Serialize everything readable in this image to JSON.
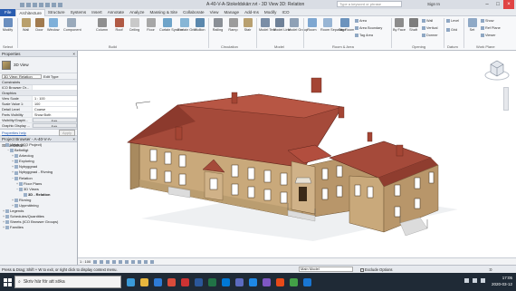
{
  "window": {
    "title": "A-40-V-A-Stokeldskärr.rvt - 3D View 3D: Relation",
    "search_placeholder": "Type a keyword or phrase",
    "sign_in": "Sign In"
  },
  "tabs": [
    "File",
    "Architecture",
    "Structure",
    "Systems",
    "Insert",
    "Annotate",
    "Analyze",
    "Massing & Site",
    "Collaborate",
    "View",
    "Manage",
    "Add-Ins",
    "Modify",
    "ICO"
  ],
  "active_tab": "Architecture",
  "ribbon": {
    "select": {
      "label": "Modify",
      "panel": "Select"
    },
    "build": {
      "panel": "Build",
      "buttons": [
        "Wall",
        "Door",
        "Window",
        "Component",
        "Column",
        "Roof",
        "Ceiling",
        "Floor",
        "Curtain System",
        "Curtain Grid",
        "Mullion"
      ]
    },
    "circulation": {
      "panel": "Circulation",
      "buttons": [
        "Railing",
        "Ramp",
        "Stair"
      ]
    },
    "model": {
      "panel": "Model",
      "buttons": [
        "Model Text",
        "Model Line",
        "Model Group"
      ]
    },
    "room_area": {
      "panel": "Room & Area",
      "buttons": [
        "Room",
        "Room Separator",
        "Tag Room",
        "Area",
        "Area Boundary",
        "Tag Area"
      ]
    },
    "opening": {
      "panel": "Opening",
      "buttons": [
        "By Face",
        "Shaft",
        "Wall",
        "Vertical",
        "Dormer"
      ]
    },
    "datum": {
      "panel": "Datum",
      "buttons": [
        "Level",
        "Grid"
      ]
    },
    "work_plane": {
      "panel": "Work Plane",
      "buttons": [
        "Set",
        "Show",
        "Ref Plane",
        "Viewer"
      ]
    }
  },
  "properties": {
    "header": "Properties",
    "type": "3D View",
    "instance": "3D View: Relation",
    "edit_type": "Edit Type",
    "group": "Constraints",
    "filter_value": "ICO Browser Or...",
    "group2": "Graphics",
    "rows": [
      {
        "k": "View Scale",
        "v": "1 : 100"
      },
      {
        "k": "Scale Value  1:",
        "v": "100"
      },
      {
        "k": "Detail Level",
        "v": "Coarse"
      },
      {
        "k": "Parts Visibility",
        "v": "Show Both"
      },
      {
        "k": "Visibility/Graphi...",
        "v": "Edit..."
      },
      {
        "k": "Graphic Display ...",
        "v": "Edit..."
      }
    ],
    "help_link": "Properties help",
    "apply": "Apply"
  },
  "browser": {
    "header": "Project Browser - A-40-V-A-Stokeldskärr...",
    "rows": [
      {
        "label": "Views (ICO Project)",
        "indent": 0,
        "toggle": "−"
      },
      {
        "label": "Befintligt",
        "indent": 1,
        "toggle": "−"
      },
      {
        "label": "Arkeolog",
        "indent": 2,
        "toggle": "+"
      },
      {
        "label": "Exploring",
        "indent": 2,
        "toggle": "+"
      },
      {
        "label": "Nybyggnad",
        "indent": 2,
        "toggle": "+"
      },
      {
        "label": "Nybyggnad - Rivning",
        "indent": 2,
        "toggle": "+"
      },
      {
        "label": "Relation",
        "indent": 2,
        "toggle": "−"
      },
      {
        "label": "Floor Plans",
        "indent": 3,
        "toggle": "+"
      },
      {
        "label": "3D Views",
        "indent": 3,
        "toggle": "−"
      },
      {
        "label": "3D - Relation",
        "indent": 4,
        "toggle": "",
        "bold": true
      },
      {
        "label": "Rivning",
        "indent": 2,
        "toggle": "+"
      },
      {
        "label": "Uppmätning",
        "indent": 2,
        "toggle": "+"
      },
      {
        "label": "Legends",
        "indent": 0,
        "toggle": "+"
      },
      {
        "label": "Schedules/Quantities",
        "indent": 0,
        "toggle": "+"
      },
      {
        "label": "Sheets (ICO Browser Groups)",
        "indent": 0,
        "toggle": "+"
      },
      {
        "label": "Families",
        "indent": 0,
        "toggle": "+"
      }
    ]
  },
  "view_control": {
    "scale": "1 : 100"
  },
  "status": {
    "message": "Press & Drag; Shift + W to exit, or right click to display context menu.",
    "model": "Main Model",
    "exclude": "Exclude Options",
    "filter": ":0"
  },
  "taskbar": {
    "search": "Skriv här för att söka",
    "time": "17:05",
    "date": "2020-03-12"
  }
}
